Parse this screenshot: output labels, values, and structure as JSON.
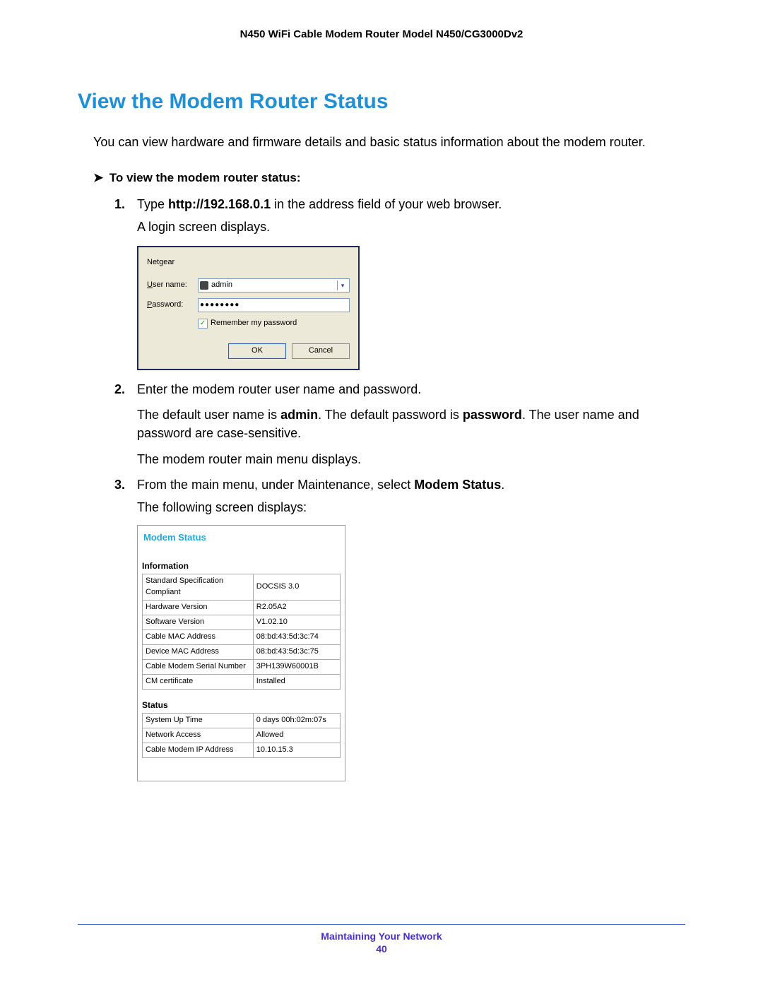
{
  "docHeader": "N450 WiFi Cable Modem Router Model N450/CG3000Dv2",
  "sectionTitle": "View the Modem Router Status",
  "intro": "You can view hardware and firmware details and basic status information about the modem router.",
  "procHeading": "To view the modem router status:",
  "steps": {
    "s1_a": "Type ",
    "s1_bold": "http://192.168.0.1",
    "s1_b": " in the address field of your web browser.",
    "s1_after": "A login screen displays.",
    "s2": "Enter the modem router user name and password.",
    "s2_p1a": "The default user name is ",
    "s2_p1b": "admin",
    "s2_p1c": ". The default password is ",
    "s2_p1d": "password",
    "s2_p1e": ". The user name and password are case-sensitive.",
    "s2_p2": "The modem router main menu displays.",
    "s3a": "From the main menu, under Maintenance, select ",
    "s3b": "Modem Status",
    "s3c": ".",
    "s3_after": "The following screen displays:"
  },
  "login": {
    "brand": "Netgear",
    "userLabelPre": "U",
    "userLabelRest": "ser name:",
    "passLabelPre": "P",
    "passLabelRest": "assword:",
    "userValue": "admin",
    "passMasked": "●●●●●●●●",
    "rememberPre": "R",
    "rememberRest": "emember my password",
    "ok": "OK",
    "cancel": "Cancel"
  },
  "modemStatus": {
    "title": "Modem Status",
    "infoCaption": "Information",
    "info": [
      {
        "k": "Standard Specification Compliant",
        "v": "DOCSIS 3.0"
      },
      {
        "k": "Hardware Version",
        "v": "R2.05A2"
      },
      {
        "k": "Software Version",
        "v": "V1.02.10"
      },
      {
        "k": "Cable MAC Address",
        "v": "08:bd:43:5d:3c:74"
      },
      {
        "k": "Device MAC Address",
        "v": "08:bd:43:5d:3c:75"
      },
      {
        "k": "Cable Modem Serial Number",
        "v": "3PH139W60001B"
      },
      {
        "k": "CM certificate",
        "v": "Installed"
      }
    ],
    "statusCaption": "Status",
    "status": [
      {
        "k": "System Up Time",
        "v": "0 days 00h:02m:07s"
      },
      {
        "k": "Network Access",
        "v": "Allowed"
      },
      {
        "k": "Cable Modem IP Address",
        "v": "10.10.15.3"
      }
    ]
  },
  "footer": {
    "text": "Maintaining Your Network",
    "page": "40"
  }
}
